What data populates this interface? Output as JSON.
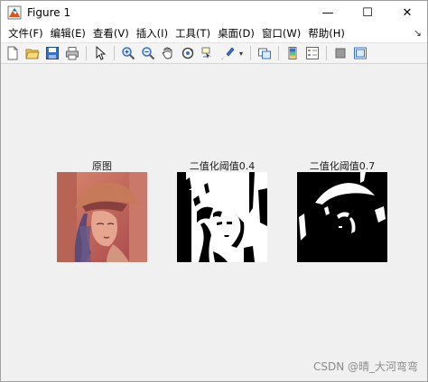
{
  "window": {
    "title": "Figure 1"
  },
  "window_controls": {
    "minimize": "—",
    "maximize": "☐",
    "close": "✕"
  },
  "menu": [
    "文件(F)",
    "编辑(E)",
    "查看(V)",
    "插入(I)",
    "工具(T)",
    "桌面(D)",
    "窗口(W)",
    "帮助(H)"
  ],
  "menu_right": "↘",
  "toolbar_icons": [
    "new-figure-icon",
    "open-file-icon",
    "save-icon",
    "print-icon",
    "pointer-icon",
    "zoom-in-icon",
    "zoom-out-icon",
    "pan-hand-icon",
    "rotate-3d-icon",
    "data-cursor-icon",
    "brush-icon",
    "link-icon",
    "colorbar-icon",
    "legend-icon",
    "hide-plot-tools-icon",
    "show-plot-tools-icon"
  ],
  "subplots": [
    {
      "title": "原图",
      "kind": "original-color-photo"
    },
    {
      "title": "二值化阈值0.4",
      "kind": "binary-threshold-low"
    },
    {
      "title": "二值化阈值0.7",
      "kind": "binary-threshold-high"
    }
  ],
  "watermark": "CSDN @晴_大河弯弯",
  "colors": {
    "background": "#f0f0f0",
    "titlebar": "#ffffff",
    "photo_tone": "#c8675a"
  }
}
